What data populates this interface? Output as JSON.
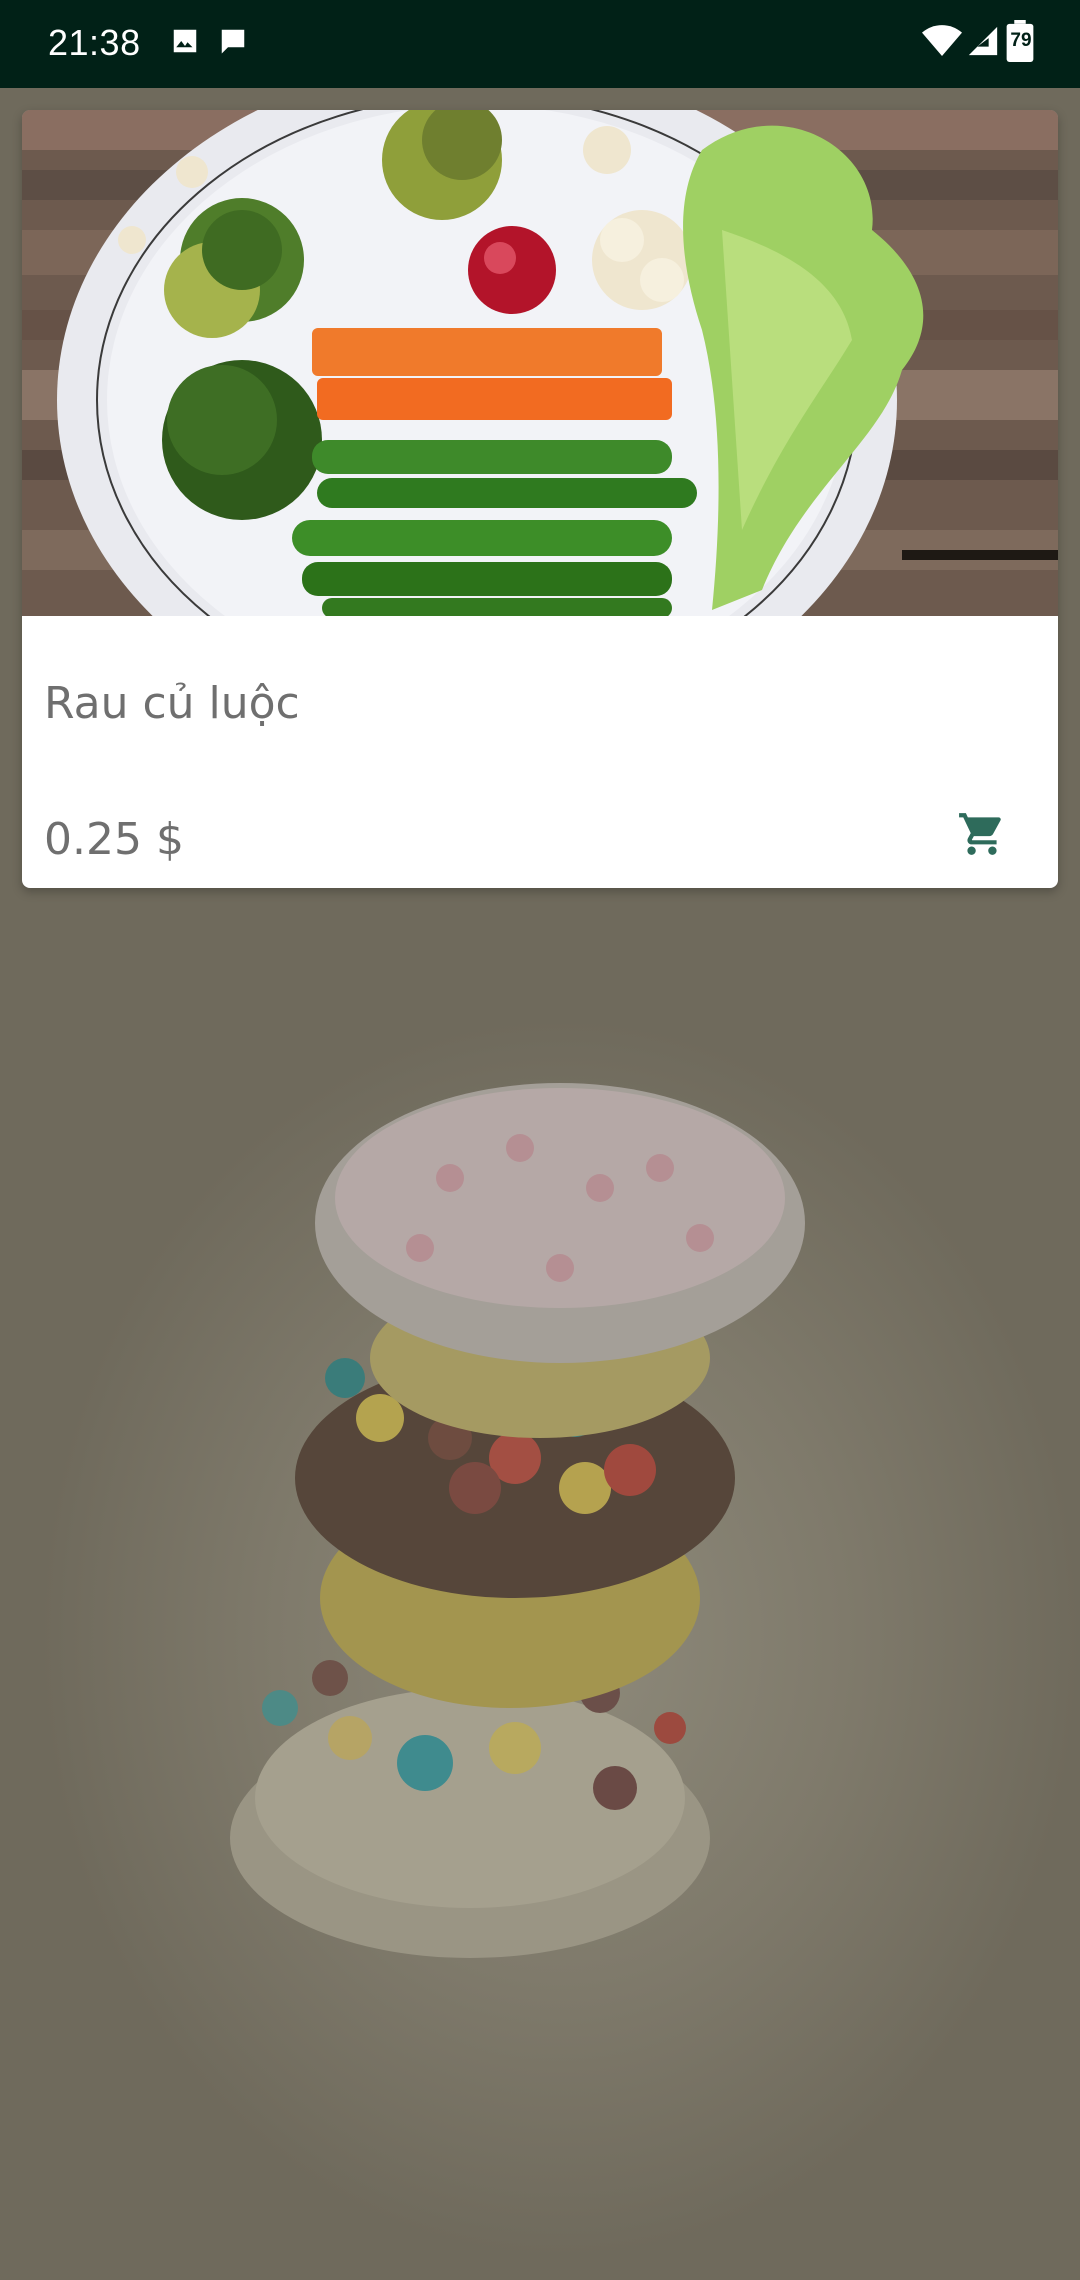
{
  "status_bar": {
    "time": "21:38",
    "battery_level": "79",
    "icons": [
      "gallery-icon",
      "message-icon",
      "wifi-icon",
      "signal-icon",
      "battery-icon"
    ]
  },
  "product": {
    "name": "Rau củ luộc",
    "price": "0.25 $",
    "image": "boiled-vegetables-plate",
    "action_icon": "cart-icon"
  },
  "background": {
    "image": "stacked-cupcakes"
  },
  "colors": {
    "status_bar_bg": "#012117",
    "accent": "#2e6b5b",
    "text_secondary": "#6f6f6f",
    "overlay": "#7a7566"
  }
}
